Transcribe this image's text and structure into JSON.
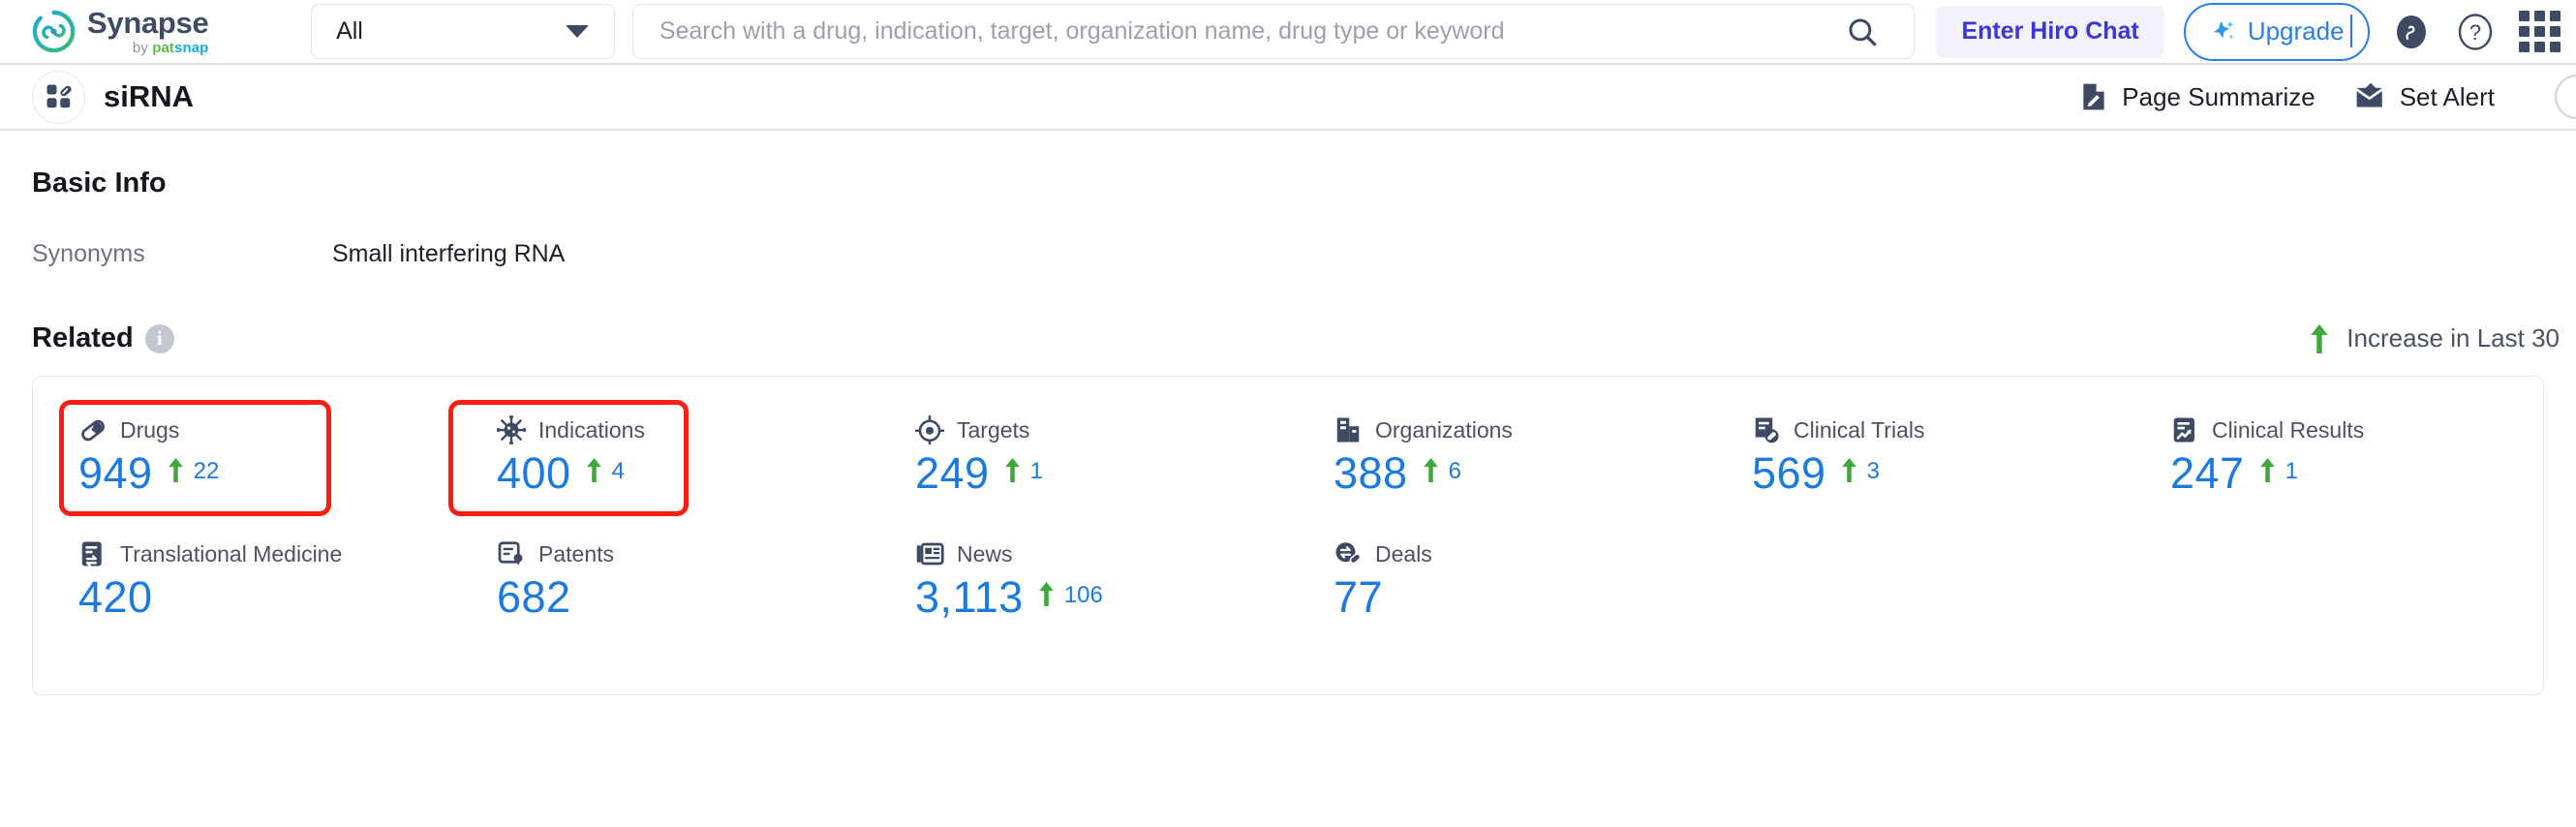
{
  "header": {
    "brand": {
      "name": "Synapse",
      "by": "by ",
      "pat": "pat",
      "snap": "snap",
      "logo_icon": "synapse-logo-icon"
    },
    "category_select": {
      "value": "All",
      "caret_icon": "chevron-down-icon"
    },
    "search": {
      "value": "",
      "placeholder": "Search with a drug, indication, target, organization name, drug type or keyword",
      "icon": "search-icon"
    },
    "hiro_chat_label": "Enter Hiro Chat",
    "upgrade_label": "Upgrade",
    "upgrade_icon": "star-sparkle-icon",
    "patsnap_icon": "patsnap-circle-icon",
    "help_icon": "question-mark-icon",
    "apps_icon": "grid-apps-icon"
  },
  "entity": {
    "avatar_icon": "drug-type-icon",
    "title": "siRNA",
    "actions": [
      {
        "label": "Page Summarize",
        "icon": "document-pencil-icon"
      },
      {
        "label": "Set Alert",
        "icon": "envelope-alert-icon"
      }
    ]
  },
  "basic_info": {
    "title": "Basic Info",
    "rows": [
      {
        "label": "Synonyms",
        "value": "Small interfering RNA"
      }
    ]
  },
  "related": {
    "title": "Related",
    "info_icon": "info-icon",
    "info_glyph": "i",
    "legend": {
      "arrow_icon": "arrow-up-icon",
      "text": "Increase in Last 30"
    },
    "colors": {
      "value_blue": "#1b7ae0",
      "arrow_green": "#3da93c",
      "highlight_red": "#fa1e0e",
      "label_gray": "#4a5163"
    },
    "highlighted": [
      "Drugs",
      "Indications"
    ],
    "stats": [
      {
        "label": "Drugs",
        "icon": "pill-capsule-icon",
        "value": "949",
        "delta": "22",
        "has_delta": true
      },
      {
        "label": "Indications",
        "icon": "virus-icon",
        "value": "400",
        "delta": "4",
        "has_delta": true
      },
      {
        "label": "Targets",
        "icon": "target-crosshair-icon",
        "value": "249",
        "delta": "1",
        "has_delta": true
      },
      {
        "label": "Organizations",
        "icon": "building-icon",
        "value": "388",
        "delta": "6",
        "has_delta": true
      },
      {
        "label": "Clinical Trials",
        "icon": "document-pill-icon",
        "value": "569",
        "delta": "3",
        "has_delta": true
      },
      {
        "label": "Clinical Results",
        "icon": "document-chart-icon",
        "value": "247",
        "delta": "1",
        "has_delta": true
      },
      {
        "label": "Translational Medicine",
        "icon": "document-exchange-icon",
        "value": "420",
        "delta": "",
        "has_delta": false
      },
      {
        "label": "Patents",
        "icon": "patent-seal-icon",
        "value": "682",
        "delta": "",
        "has_delta": false
      },
      {
        "label": "News",
        "icon": "newspaper-icon",
        "value": "3,113",
        "delta": "106",
        "has_delta": true
      },
      {
        "label": "Deals",
        "icon": "deal-exchange-icon",
        "value": "77",
        "delta": "",
        "has_delta": false
      }
    ]
  }
}
